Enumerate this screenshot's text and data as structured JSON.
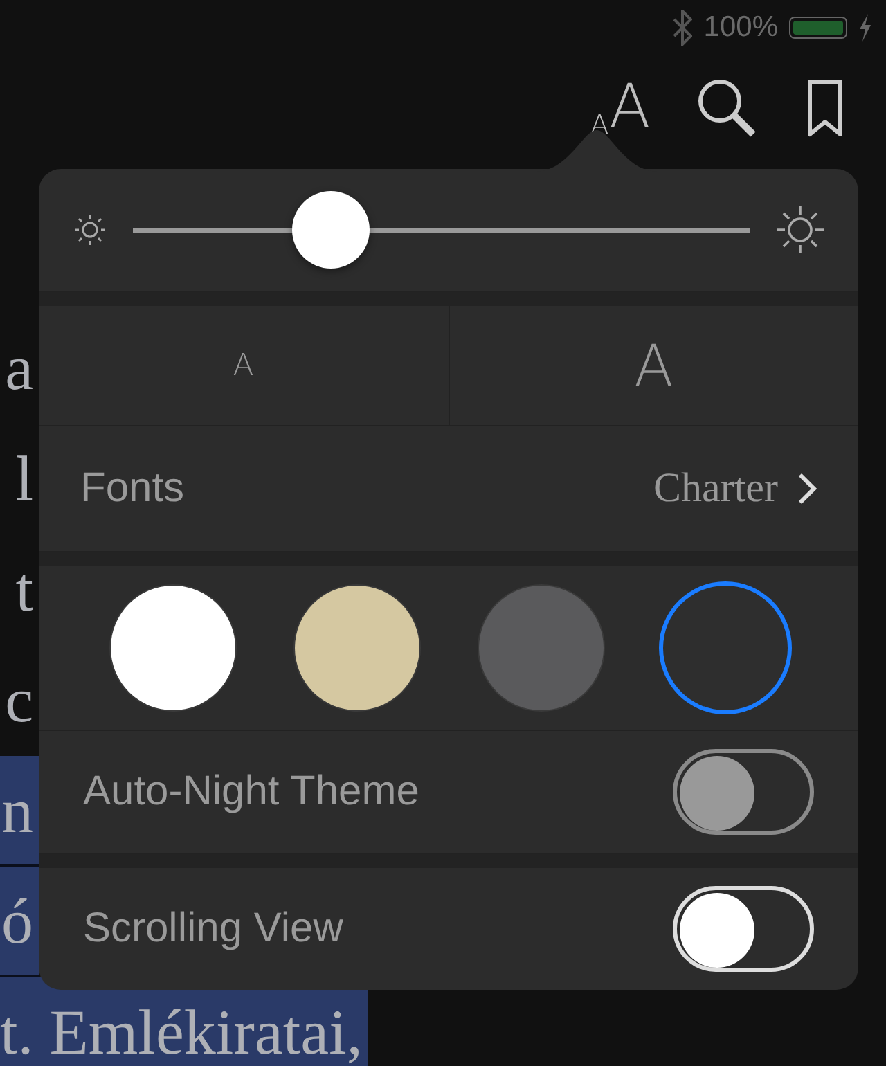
{
  "status_bar": {
    "battery_percent": "100%"
  },
  "toolbar": {
    "font_button": {
      "small": "A",
      "large": "A",
      "selected": true
    }
  },
  "book_text": [
    {
      "text": "a",
      "highlighted": false
    },
    {
      "text": "l",
      "highlighted": false
    },
    {
      "text": "t",
      "highlighted": false
    },
    {
      "text": "c",
      "highlighted": false
    },
    {
      "text": "n",
      "highlighted": true
    },
    {
      "text": "ó",
      "highlighted": true
    },
    {
      "text": "t. Emlékiratai,",
      "highlighted": true
    }
  ],
  "popover": {
    "brightness": {
      "level": 0.32
    },
    "font_size": {
      "smaller": "A",
      "larger": "A"
    },
    "fonts": {
      "label": "Fonts",
      "value": "Charter"
    },
    "themes": [
      {
        "color": "#ffffff",
        "selected": false
      },
      {
        "color": "#d5c8a1",
        "selected": false
      },
      {
        "color": "#5a5a5c",
        "selected": false
      },
      {
        "color": "#2e2e2e",
        "selected": true
      }
    ],
    "toggles": [
      {
        "label": "Auto-Night Theme",
        "on": false,
        "disabled": true
      },
      {
        "label": "Scrolling View",
        "on": false,
        "disabled": false
      }
    ]
  }
}
